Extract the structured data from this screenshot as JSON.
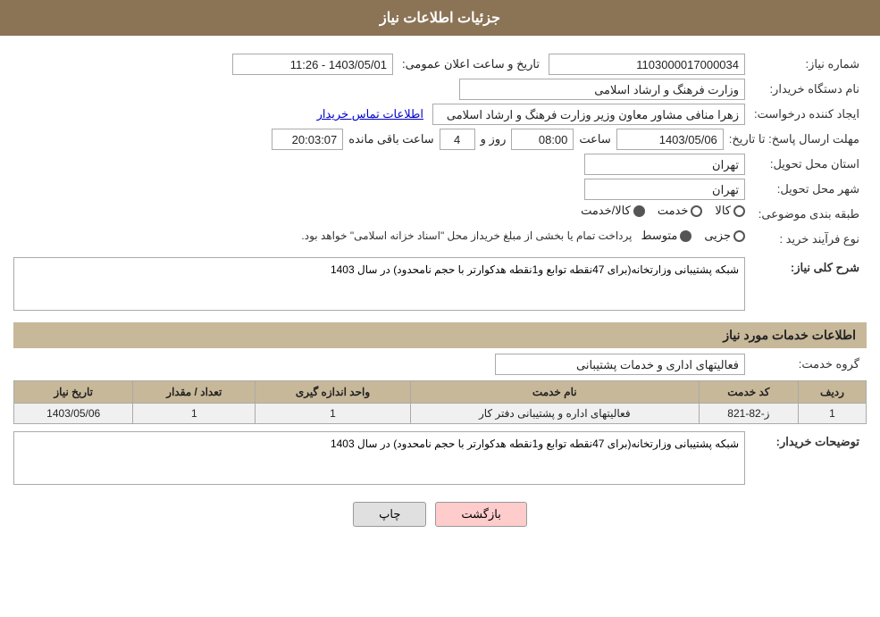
{
  "header": {
    "title": "جزئیات اطلاعات نیاز"
  },
  "fields": {
    "need_number_label": "شماره نیاز:",
    "need_number_value": "1103000017000034",
    "announce_date_label": "تاریخ و ساعت اعلان عمومی:",
    "announce_date_value": "1403/05/01 - 11:26",
    "org_name_label": "نام دستگاه خریدار:",
    "org_name_value": "وزارت فرهنگ و ارشاد اسلامی",
    "creator_label": "ایجاد کننده درخواست:",
    "creator_value": "زهرا منافی مشاور معاون وزیر وزارت فرهنگ و ارشاد اسلامی",
    "creator_link": "اطلاعات تماس خریدار",
    "deadline_label": "مهلت ارسال پاسخ: تا تاریخ:",
    "deadline_date": "1403/05/06",
    "deadline_time_label": "ساعت",
    "deadline_time": "08:00",
    "deadline_days_label": "روز و",
    "deadline_days": "4",
    "deadline_remaining_label": "ساعت باقی مانده",
    "deadline_remaining": "20:03:07",
    "province_label": "استان محل تحویل:",
    "province_value": "تهران",
    "city_label": "شهر محل تحویل:",
    "city_value": "تهران",
    "category_label": "طبقه بندی موضوعی:",
    "category_options": [
      {
        "label": "کالا",
        "selected": false
      },
      {
        "label": "خدمت",
        "selected": false
      },
      {
        "label": "کالا/خدمت",
        "selected": true
      }
    ],
    "purchase_type_label": "نوع فرآیند خرید :",
    "purchase_type_options": [
      {
        "label": "جزیی",
        "selected": false
      },
      {
        "label": "متوسط",
        "selected": true
      }
    ],
    "purchase_notice": "پرداخت تمام یا بخشی از مبلغ خریداز محل \"اسناد خزانه اسلامی\" خواهد بود.",
    "need_description_label": "شرح کلی نیاز:",
    "need_description_value": "شبکه پشتیبانی وزارتخانه(برای 47نقطه توابع و1نقطه هدکوارتر با حجم نامحدود) در سال 1403"
  },
  "services_section": {
    "title": "اطلاعات خدمات مورد نیاز",
    "service_group_label": "گروه خدمت:",
    "service_group_value": "فعالیتهای اداری و خدمات پشتیبانی",
    "table_headers": [
      "ردیف",
      "کد خدمت",
      "نام خدمت",
      "واحد اندازه گیری",
      "تعداد / مقدار",
      "تاریخ نیاز"
    ],
    "table_rows": [
      {
        "row": "1",
        "code": "ز-82-821",
        "name": "فعالیتهای اداره و پشتیبانی دفتر کار",
        "unit": "1",
        "quantity": "1",
        "date": "1403/05/06"
      }
    ]
  },
  "buyer_description_label": "توضیحات خریدار:",
  "buyer_description_value": "شبکه پشتیبانی وزارتخانه(برای 47نقطه توابع و1نقطه هدکوارتر با حجم نامحدود) در سال 1403",
  "buttons": {
    "print": "چاپ",
    "back": "بازگشت"
  }
}
